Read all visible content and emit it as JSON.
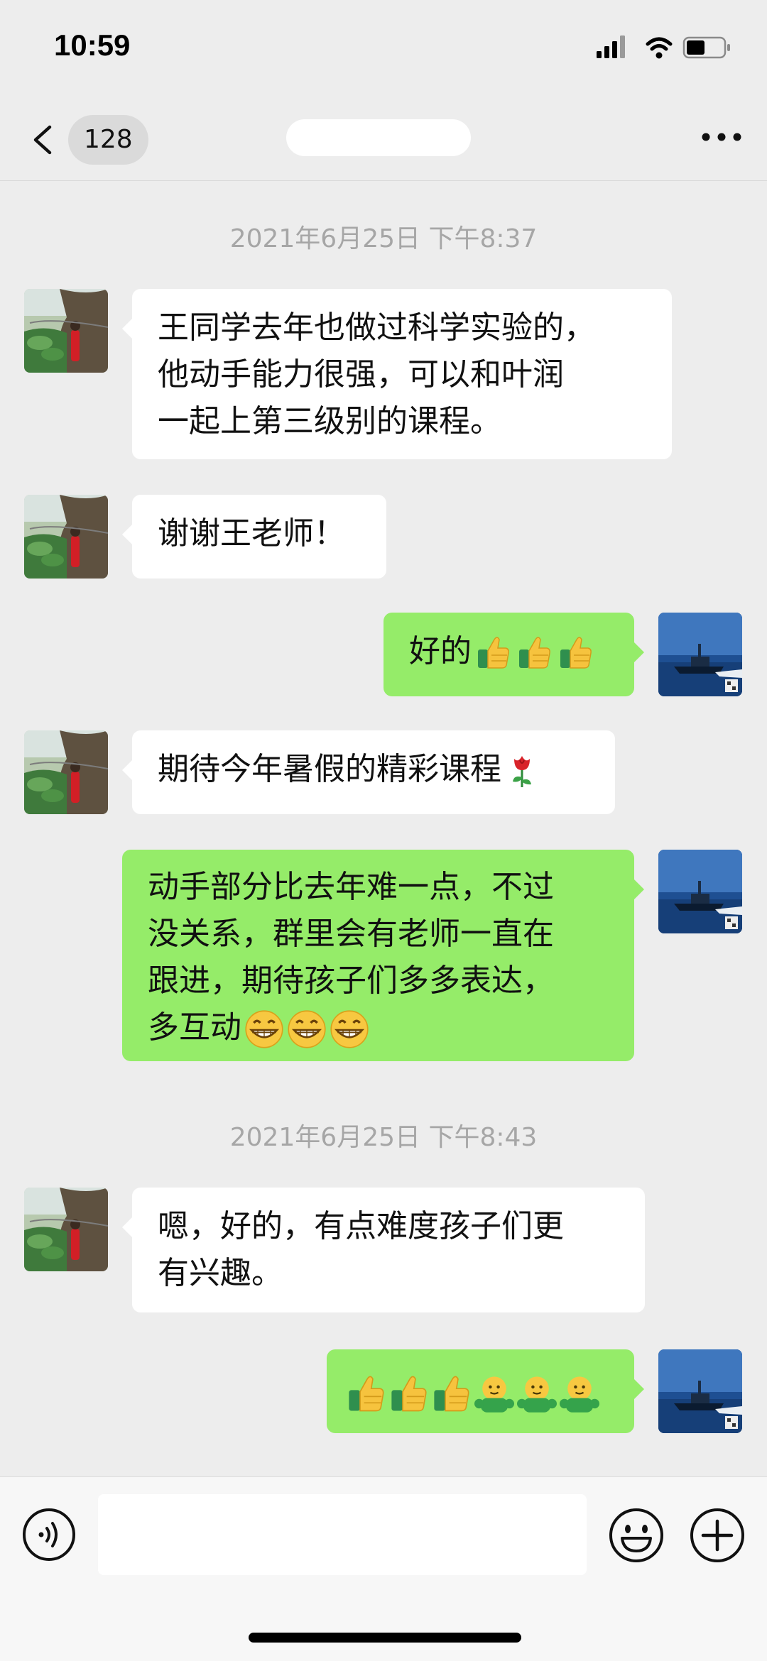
{
  "status_bar": {
    "time": "10:59",
    "battery_level": 0.5
  },
  "nav": {
    "unread_count": "128"
  },
  "colors": {
    "incoming_bubble": "#FFFFFF",
    "outgoing_bubble": "#95EC69",
    "background": "#EDEDED"
  },
  "messages": {
    "timestamp1": "2021年6月25日 下午8:37",
    "m1": {
      "line1": "王同学去年也做过科学实验的，",
      "line2": "他动手能力很强，可以和叶润",
      "line3": "一起上第三级别的课程。"
    },
    "m2": {
      "text": "谢谢王老师！"
    },
    "m3": {
      "text": "好的",
      "emojis": [
        "thumbs-up",
        "thumbs-up",
        "thumbs-up"
      ]
    },
    "m4": {
      "text": "期待今年暑假的精彩课程",
      "emojis": [
        "rose"
      ]
    },
    "m5": {
      "line1": "动手部分比去年难一点，不过",
      "line2": "没关系，群里会有老师一直在",
      "line3": "跟进，期待孩子们多多表达，",
      "line4": "多互动",
      "emojis": [
        "grin",
        "grin",
        "grin"
      ]
    },
    "timestamp2": "2021年6月25日 下午8:43",
    "m6": {
      "line1": "嗯，好的，有点难度孩子们更",
      "line2": "有兴趣。"
    },
    "m7": {
      "emojis": [
        "thumbs-up",
        "thumbs-up",
        "thumbs-up",
        "hug",
        "hug",
        "hug"
      ]
    }
  },
  "icons": {
    "back": "chevron-left-icon",
    "more": "more-dots-icon",
    "voice": "voice-icon",
    "emoji": "smiley-icon",
    "plus": "plus-icon"
  }
}
